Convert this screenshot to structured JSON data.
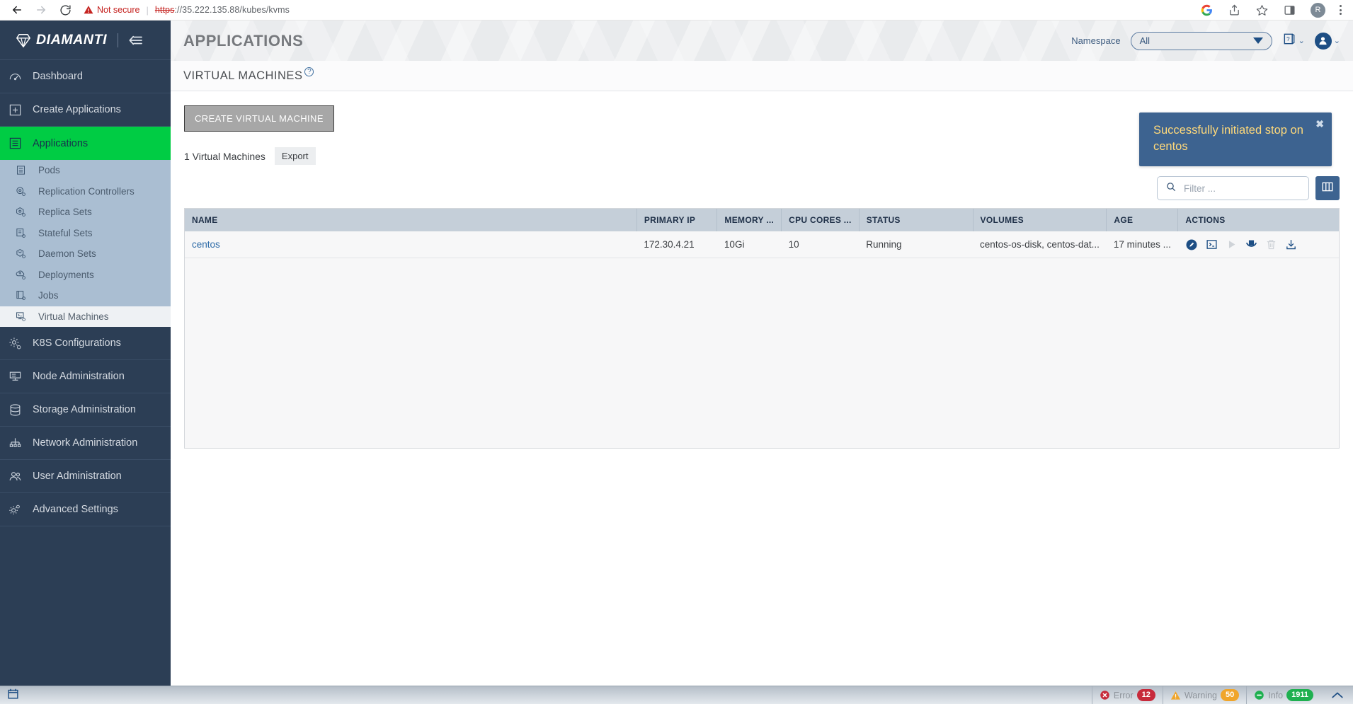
{
  "browser": {
    "back_icon": "arrow-left-icon",
    "forward_icon": "arrow-right-icon",
    "reload_icon": "reload-icon",
    "security_label": "Not secure",
    "url_scheme": "https",
    "url_rest": "://35.222.135.88/kubes/kvms",
    "google_icon": "google-icon",
    "share_icon": "share-icon",
    "bookmark_icon": "star-icon",
    "sidepanel_icon": "side-panel-icon",
    "profile_initial": "R",
    "menu_icon": "kebab-menu-icon"
  },
  "sidebar": {
    "brand": "DIAMANTI",
    "collapse_icon": "collapse-sidebar-icon",
    "items": [
      {
        "label": "Dashboard",
        "icon": "gauge-icon",
        "active": false
      },
      {
        "label": "Create Applications",
        "icon": "plus-square-icon",
        "active": false
      },
      {
        "label": "Applications",
        "icon": "list-square-icon",
        "active": true
      }
    ],
    "sub_items": [
      {
        "label": "Pods",
        "icon": "pods-icon",
        "active": false
      },
      {
        "label": "Replication Controllers",
        "icon": "replication-controllers-icon",
        "active": false
      },
      {
        "label": "Replica Sets",
        "icon": "replica-sets-icon",
        "active": false
      },
      {
        "label": "Stateful Sets",
        "icon": "stateful-sets-icon",
        "active": false
      },
      {
        "label": "Daemon Sets",
        "icon": "daemon-sets-icon",
        "active": false
      },
      {
        "label": "Deployments",
        "icon": "deployments-icon",
        "active": false
      },
      {
        "label": "Jobs",
        "icon": "jobs-icon",
        "active": false
      },
      {
        "label": "Virtual Machines",
        "icon": "virtual-machines-icon",
        "active": true
      }
    ],
    "items_lower": [
      {
        "label": "K8S Configurations",
        "icon": "gear-cog-icon"
      },
      {
        "label": "Node Administration",
        "icon": "node-icon"
      },
      {
        "label": "Storage Administration",
        "icon": "database-icon"
      },
      {
        "label": "Network Administration",
        "icon": "network-icon"
      },
      {
        "label": "User Administration",
        "icon": "users-icon"
      },
      {
        "label": "Advanced Settings",
        "icon": "settings-gears-icon"
      }
    ]
  },
  "header": {
    "title": "APPLICATIONS",
    "namespace_label": "Namespace",
    "namespace_value": "All",
    "help_icon": "help-book-icon",
    "user_icon": "user-avatar-icon"
  },
  "section": {
    "title": "VIRTUAL MACHINES",
    "help_marker": "?"
  },
  "toolbar": {
    "create_label": "CREATE VIRTUAL MACHINE",
    "count_label": "1 Virtual Machines",
    "export_label": "Export",
    "search_placeholder": "Filter ...",
    "search_value": "",
    "search_icon": "search-icon",
    "columns_icon": "columns-toggle-icon"
  },
  "table": {
    "columns": [
      "NAME",
      "PRIMARY IP",
      "MEMORY ...",
      "CPU CORES ...",
      "STATUS",
      "VOLUMES",
      "AGE",
      "ACTIONS"
    ],
    "rows": [
      {
        "name": "centos",
        "primary_ip": "172.30.4.21",
        "memory": "10Gi",
        "cpu_cores": "10",
        "status": "Running",
        "volumes": "centos-os-disk, centos-dat...",
        "age": "17 minutes ...",
        "actions": [
          {
            "icon": "edit-pencil-icon",
            "enabled": true
          },
          {
            "icon": "console-terminal-icon",
            "enabled": true
          },
          {
            "icon": "play-start-icon",
            "enabled": false
          },
          {
            "icon": "stop-icon",
            "enabled": true
          },
          {
            "icon": "delete-trash-icon",
            "enabled": false
          },
          {
            "icon": "download-icon",
            "enabled": true
          }
        ]
      }
    ]
  },
  "toast": {
    "message": "Successfully initiated stop on centos",
    "close_icon": "close-icon",
    "bg_color": "#3d6390",
    "text_color": "#ffd97a"
  },
  "statusbar": {
    "calendar_icon": "calendar-icon",
    "cells": [
      {
        "label": "Error",
        "count": "12",
        "icon": "error-icon",
        "color": "#c72a3b"
      },
      {
        "label": "Warning",
        "count": "50",
        "icon": "warning-icon",
        "color": "#f0a52a"
      },
      {
        "label": "Info",
        "count": "1911",
        "icon": "info-icon",
        "color": "#1fb050"
      }
    ],
    "expand_icon": "chevron-up-icon"
  }
}
